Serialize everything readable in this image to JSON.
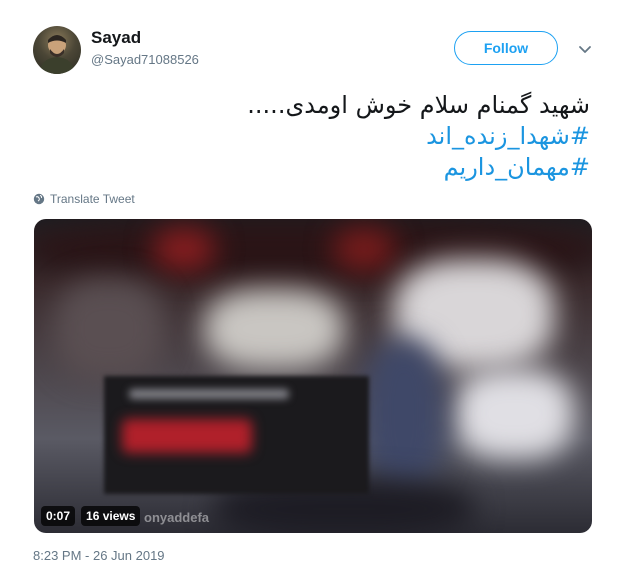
{
  "user": {
    "name": "Sayad",
    "handle": "@Sayad71088526"
  },
  "actions": {
    "follow_label": "Follow"
  },
  "tweet": {
    "lines": [
      "شهید گمنام سلام خوش اومدی.....",
      "#شهدا_زنده_اند",
      "#مهمان_داریم"
    ]
  },
  "translate": {
    "label": "Translate Tweet"
  },
  "video": {
    "duration": "0:07",
    "views": "16 views",
    "watermark": "onyaddefa"
  },
  "meta": {
    "timestamp": "8:23 PM - 26 Jun 2019"
  },
  "colors": {
    "accent": "#1da1f2",
    "hashtag": "#1b95e0",
    "secondary_text": "#657786"
  },
  "icons": {
    "more": "chevron-down-icon",
    "translate": "globe-icon"
  }
}
